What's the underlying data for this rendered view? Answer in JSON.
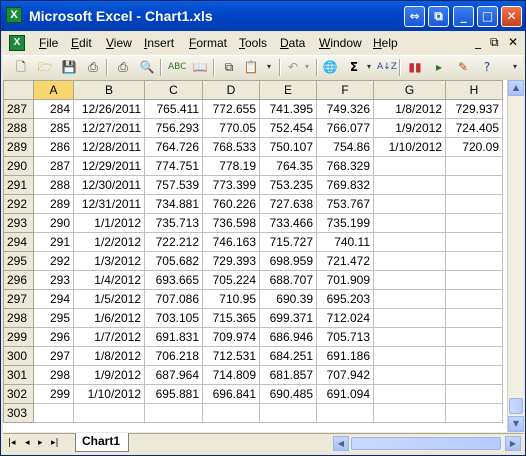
{
  "window": {
    "title": "Microsoft Excel - Chart1.xls",
    "app_icon": "X",
    "controls": [
      "shrink-icon",
      "restore-icon",
      "minimize-icon",
      "maximize-icon",
      "close-icon"
    ]
  },
  "menubar": {
    "items": [
      "File",
      "Edit",
      "View",
      "Insert",
      "Format",
      "Tools",
      "Data",
      "Window",
      "Help"
    ],
    "doc_controls": [
      "minimize",
      "restore",
      "close"
    ]
  },
  "toolbar": {
    "icons": [
      "new-icon",
      "open-icon",
      "save-icon",
      "permission-icon",
      "print-icon",
      "print-preview-icon",
      "spelling-icon",
      "research-icon",
      "copy-icon",
      "paste-icon",
      "undo-icon",
      "hyperlink-icon",
      "autosum-icon",
      "sort-icon",
      "chart-wizard-icon",
      "drawing-icon",
      "help-icon"
    ],
    "autosum_label": "Σ"
  },
  "sheet": {
    "columns": [
      "A",
      "B",
      "C",
      "D",
      "E",
      "F",
      "G",
      "H"
    ],
    "selected_column": "A",
    "active_row": 290,
    "rows": [
      {
        "num": "287",
        "cells": [
          "284",
          "12/26/2011",
          "765.411",
          "772.655",
          "741.395",
          "749.326",
          "1/8/2012",
          "729.937"
        ]
      },
      {
        "num": "288",
        "cells": [
          "285",
          "12/27/2011",
          "756.293",
          "770.05",
          "752.454",
          "766.077",
          "1/9/2012",
          "724.405"
        ]
      },
      {
        "num": "289",
        "cells": [
          "286",
          "12/28/2011",
          "764.726",
          "768.533",
          "750.107",
          "754.86",
          "1/10/2012",
          "720.09"
        ]
      },
      {
        "num": "290",
        "cells": [
          "287",
          "12/29/2011",
          "774.751",
          "778.19",
          "764.35",
          "768.329",
          "",
          ""
        ]
      },
      {
        "num": "291",
        "cells": [
          "288",
          "12/30/2011",
          "757.539",
          "773.399",
          "753.235",
          "769.832",
          "",
          ""
        ]
      },
      {
        "num": "292",
        "cells": [
          "289",
          "12/31/2011",
          "734.881",
          "760.226",
          "727.638",
          "753.767",
          "",
          ""
        ]
      },
      {
        "num": "293",
        "cells": [
          "290",
          "1/1/2012",
          "735.713",
          "736.598",
          "733.466",
          "735.199",
          "",
          ""
        ]
      },
      {
        "num": "294",
        "cells": [
          "291",
          "1/2/2012",
          "722.212",
          "746.163",
          "715.727",
          "740.11",
          "",
          ""
        ]
      },
      {
        "num": "295",
        "cells": [
          "292",
          "1/3/2012",
          "705.682",
          "729.393",
          "698.959",
          "721.472",
          "",
          ""
        ]
      },
      {
        "num": "296",
        "cells": [
          "293",
          "1/4/2012",
          "693.665",
          "705.224",
          "688.707",
          "701.909",
          "",
          ""
        ]
      },
      {
        "num": "297",
        "cells": [
          "294",
          "1/5/2012",
          "707.086",
          "710.95",
          "690.39",
          "695.203",
          "",
          ""
        ]
      },
      {
        "num": "298",
        "cells": [
          "295",
          "1/6/2012",
          "703.105",
          "715.365",
          "699.371",
          "712.024",
          "",
          ""
        ]
      },
      {
        "num": "299",
        "cells": [
          "296",
          "1/7/2012",
          "691.831",
          "709.974",
          "686.946",
          "705.713",
          "",
          ""
        ]
      },
      {
        "num": "300",
        "cells": [
          "297",
          "1/8/2012",
          "706.218",
          "712.531",
          "684.251",
          "691.186",
          "",
          ""
        ]
      },
      {
        "num": "301",
        "cells": [
          "298",
          "1/9/2012",
          "687.964",
          "714.809",
          "681.857",
          "707.942",
          "",
          ""
        ]
      },
      {
        "num": "302",
        "cells": [
          "299",
          "1/10/2012",
          "695.881",
          "696.841",
          "690.485",
          "691.094",
          "",
          ""
        ]
      },
      {
        "num": "303",
        "cells": [
          "",
          "",
          "",
          "",
          "",
          "",
          "",
          ""
        ]
      }
    ]
  },
  "tabs": {
    "nav": [
      "|◂",
      "◂",
      "▸",
      "▸|"
    ],
    "sheet_name": "Chart1"
  }
}
